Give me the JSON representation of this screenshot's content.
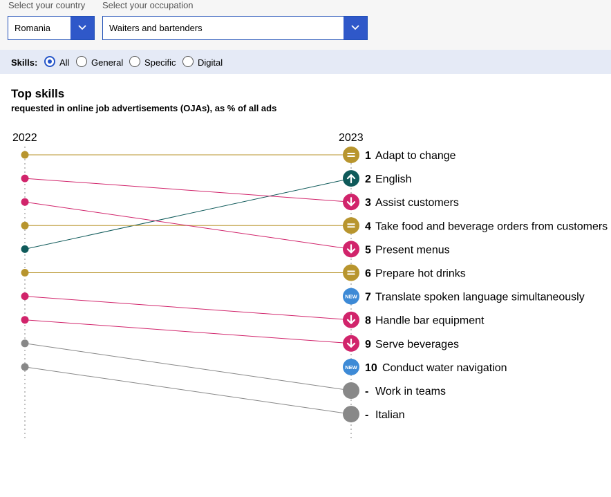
{
  "filters": {
    "country": {
      "label": "Select your country",
      "value": "Romania"
    },
    "occupation": {
      "label": "Select your occupation",
      "value": "Waiters and bartenders"
    }
  },
  "skills_filter": {
    "label": "Skills:",
    "options": [
      {
        "label": "All",
        "checked": true
      },
      {
        "label": "General",
        "checked": false
      },
      {
        "label": "Specific",
        "checked": false
      },
      {
        "label": "Digital",
        "checked": false
      }
    ]
  },
  "chart": {
    "title": "Top skills",
    "subtitle": "requested in online job advertisements (OJAs), as % of all ads"
  },
  "chart_data": {
    "type": "slope",
    "x": [
      "2022",
      "2023"
    ],
    "status_colors": {
      "same": "#b8952e",
      "down": "#d1246b",
      "up": "#0f5a5a",
      "new": "#3d8ad6",
      "dropped": "#888888"
    },
    "skills": [
      {
        "name": "Adapt to change",
        "rank_2022": 1,
        "rank_2023": "1",
        "status": "same",
        "icon": "equals-icon"
      },
      {
        "name": "English",
        "rank_2022": 5,
        "rank_2023": "2",
        "status": "up",
        "icon": "arrow-up-icon"
      },
      {
        "name": "Assist customers",
        "rank_2022": 2,
        "rank_2023": "3",
        "status": "down",
        "icon": "arrow-down-icon"
      },
      {
        "name": "Take food and beverage orders from customers",
        "rank_2022": 4,
        "rank_2023": "4",
        "status": "same",
        "icon": "equals-icon"
      },
      {
        "name": "Present menus",
        "rank_2022": 3,
        "rank_2023": "5",
        "status": "down",
        "icon": "arrow-down-icon"
      },
      {
        "name": "Prepare hot drinks",
        "rank_2022": 6,
        "rank_2023": "6",
        "status": "same",
        "icon": "equals-icon"
      },
      {
        "name": "Translate spoken language simultaneously",
        "rank_2022": null,
        "rank_2023": "7",
        "status": "new",
        "icon": "new-badge-icon",
        "badge": "NEW"
      },
      {
        "name": "Handle bar equipment",
        "rank_2022": 7,
        "rank_2023": "8",
        "status": "down",
        "icon": "arrow-down-icon"
      },
      {
        "name": "Serve beverages",
        "rank_2022": 8,
        "rank_2023": "9",
        "status": "down",
        "icon": "arrow-down-icon"
      },
      {
        "name": "Conduct water navigation",
        "rank_2022": null,
        "rank_2023": "10",
        "status": "new",
        "icon": "new-badge-icon",
        "badge": "NEW"
      },
      {
        "name": "Work in teams",
        "rank_2022": 9,
        "rank_2023": "-",
        "status": "dropped",
        "icon": "none"
      },
      {
        "name": "Italian",
        "rank_2022": 10,
        "rank_2023": "-",
        "status": "dropped",
        "icon": "none"
      }
    ]
  }
}
